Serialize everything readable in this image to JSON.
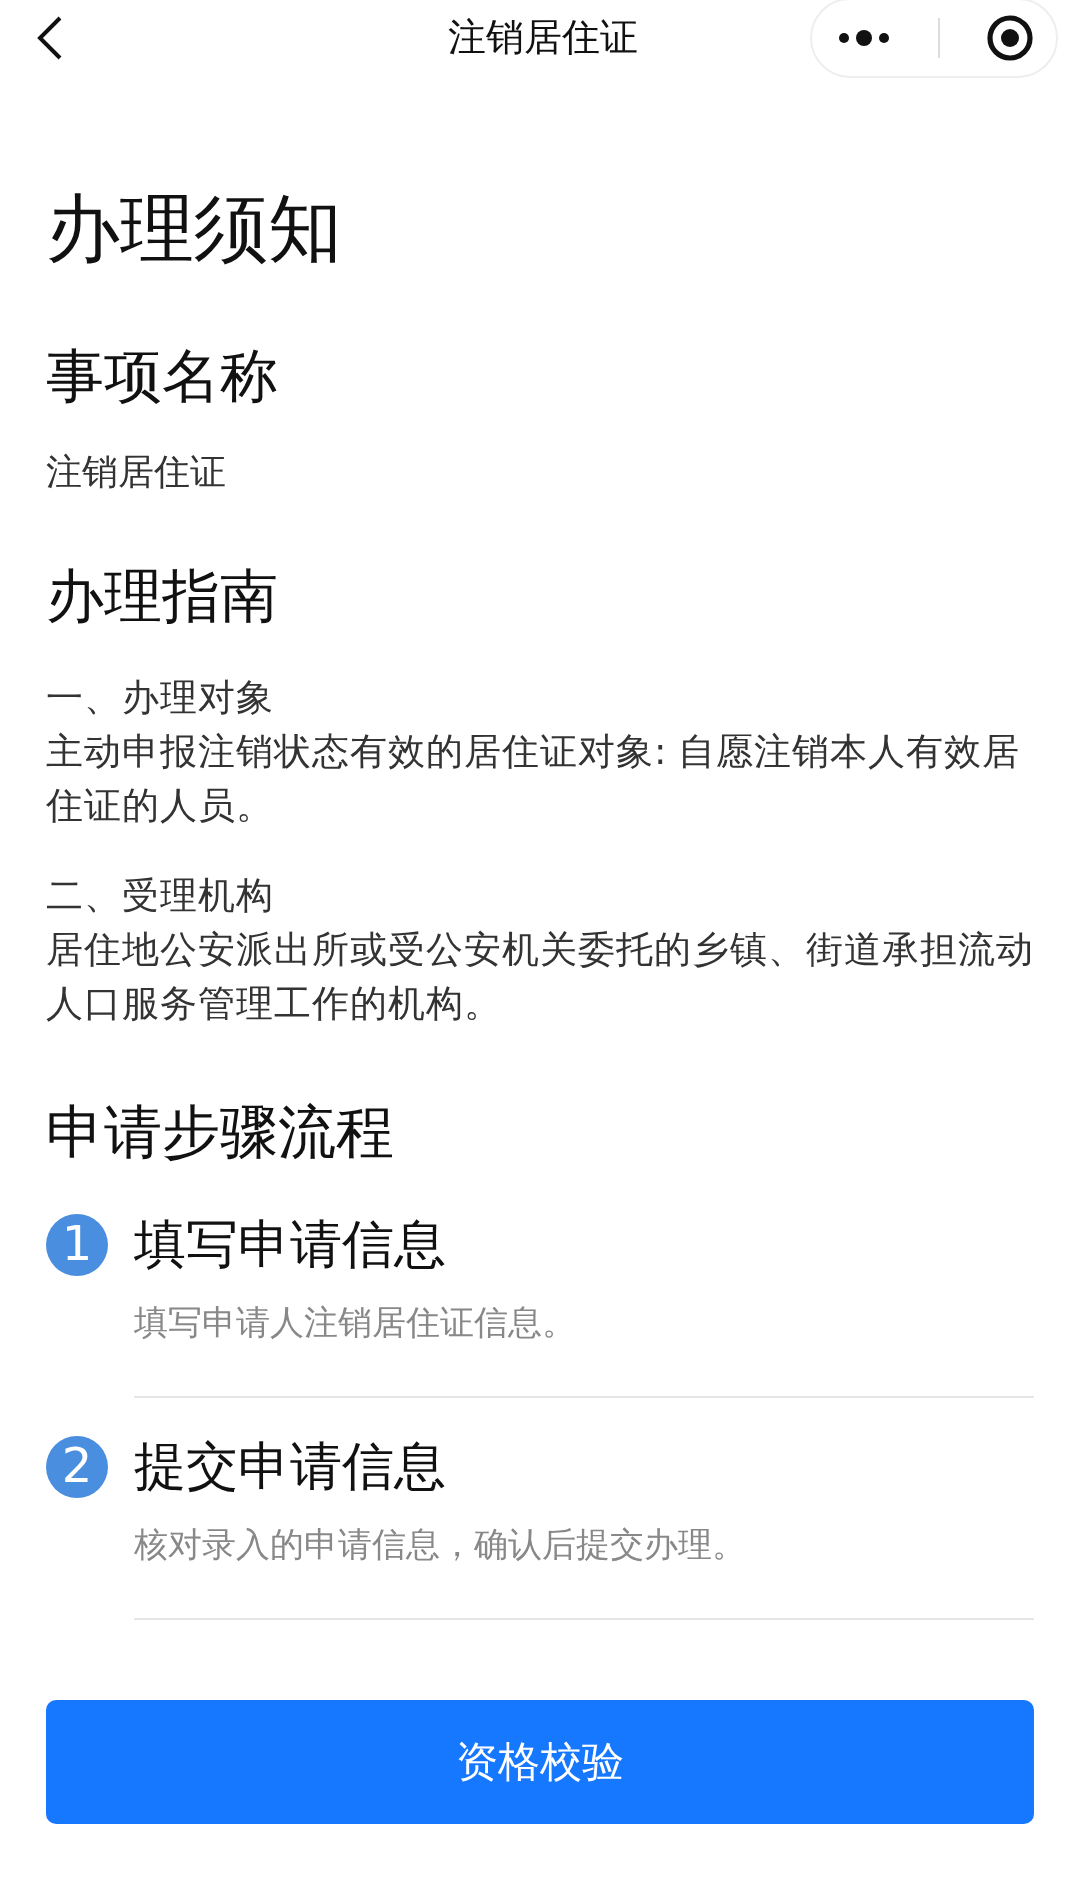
{
  "nav_bar": {
    "title": "注销居住证"
  },
  "page_title": "办理须知",
  "item_name": {
    "heading": "事项名称",
    "value": "注销居住证"
  },
  "guide": {
    "heading": "办理指南",
    "sections": [
      {
        "title": "一、办理对象",
        "body": "主动申报注销状态有效的居住证对象: 自愿注销本人有效居住证的人员。"
      },
      {
        "title": "二、受理机构",
        "body": "居住地公安派出所或受公安机关委托的乡镇、街道承担流动人口服务管理工作的机构。"
      }
    ]
  },
  "process": {
    "heading": "申请步骤流程",
    "steps": [
      {
        "number": "1",
        "title": "填写申请信息",
        "description": "填写申请人注销居住证信息。"
      },
      {
        "number": "2",
        "title": "提交申请信息",
        "description": "核对录入的申请信息，确认后提交办理。"
      }
    ]
  },
  "primary_button": "资格校验"
}
